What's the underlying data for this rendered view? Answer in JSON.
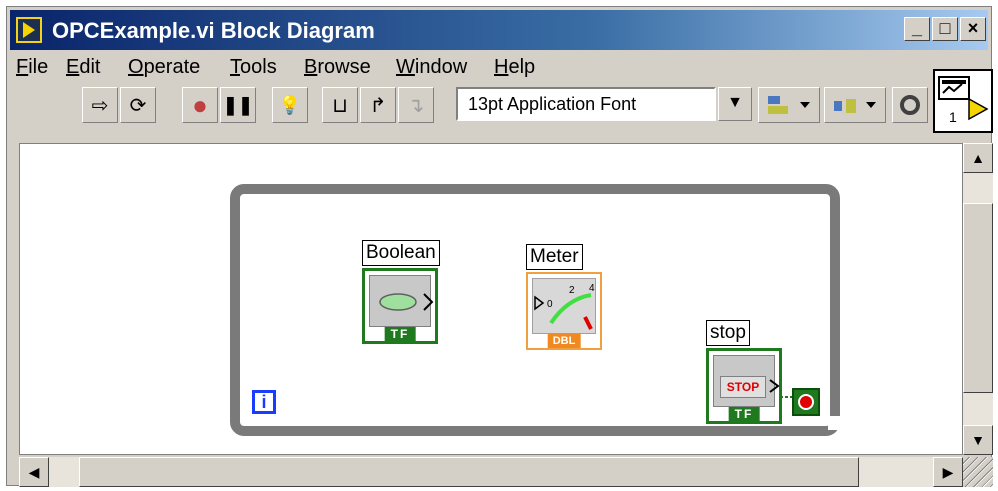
{
  "window": {
    "title": "OPCExample.vi Block Diagram",
    "controls": {
      "minimize": "_",
      "maximize": "□",
      "close": "×"
    }
  },
  "menu": {
    "items": [
      {
        "label": "File",
        "accel": "F",
        "rest": "ile"
      },
      {
        "label": "Edit",
        "accel": "E",
        "rest": "dit"
      },
      {
        "label": "Operate",
        "accel": "O",
        "rest": "perate"
      },
      {
        "label": "Tools",
        "accel": "T",
        "rest": "ools"
      },
      {
        "label": "Browse",
        "accel": "B",
        "rest": "rowse"
      },
      {
        "label": "Window",
        "accel": "W",
        "rest": "indow"
      },
      {
        "label": "Help",
        "accel": "H",
        "rest": "elp"
      }
    ]
  },
  "toolbar": {
    "font_select_value": "13pt Application Font",
    "buttons": {
      "run": "⇨",
      "run_continuous": "⟳",
      "abort": "●",
      "pause": "❚❚",
      "highlight": "💡",
      "retain": "⊔",
      "step_into": "↱",
      "step_over": "↴"
    }
  },
  "vi_icon": {
    "connector_number": "1"
  },
  "diagram": {
    "boolean_label": "Boolean",
    "boolean_tag": "TF",
    "meter_label": "Meter",
    "meter_tag": "DBL",
    "meter_scale": [
      "0",
      "2",
      "4"
    ],
    "stop_label": "stop",
    "stop_button_text": "STOP",
    "stop_tag": "TF",
    "iteration_label": "i"
  },
  "colors": {
    "title_gradient_start": "#0a246a",
    "boolean_terminal": "#1f7a1f",
    "numeric_terminal": "#f08a20",
    "loop_border": "#7a7a7a",
    "iteration_terminal": "#1a3cff",
    "stop_red": "#e00000"
  }
}
